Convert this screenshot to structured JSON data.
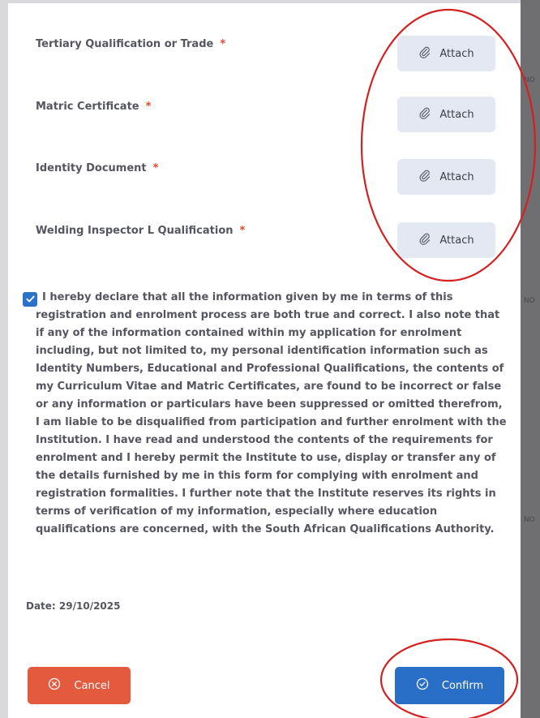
{
  "fields": [
    {
      "label": "Tertiary Qualification or Trade",
      "required": "*",
      "button": "Attach"
    },
    {
      "label": "Matric Certificate",
      "required": "*",
      "button": "Attach"
    },
    {
      "label": "Identity Document",
      "required": "*",
      "button": "Attach"
    },
    {
      "label": "Welding Inspector L Qualification",
      "required": "*",
      "button": "Attach"
    }
  ],
  "declaration": {
    "checked": true,
    "text": "I hereby declare that all the information given by me in terms of this registration and enrolment process are both true and correct. I also note that if any of the information contained within my application for enrolment including, but not limited to, my personal identification information such as Identity Numbers, Educational and Professional Qualifications, the contents of my Curriculum Vitae and Matric Certificates, are found to be incorrect or false or any information or particulars have been suppressed or omitted therefrom, I am liable to be disqualified from participation and further enrolment with the Institution. I have read and understood the contents of the requirements for enrolment and I hereby permit the Institute to use, display or transfer any of the details furnished by me in this form for complying with enrolment and registration formalities. I further note that the Institute reserves its rights in terms of verification of my information, especially where education qualifications are concerned, with the South African Qualifications Authority."
  },
  "date_text": "Date: 29/10/2025",
  "buttons": {
    "cancel": "Cancel",
    "confirm": "Confirm"
  },
  "icons": {
    "attach": "paperclip-icon",
    "cancel": "close-circle-icon",
    "confirm": "check-circle-icon",
    "checkbox": "checkmark-icon"
  },
  "colors": {
    "cancel": "#e35a3e",
    "confirm": "#2a6fc7",
    "attach_bg": "#e3e8f2",
    "required": "#e0452b",
    "annotation": "#d42020"
  },
  "overlay_snippets": [
    "NO",
    "NO",
    "NO"
  ]
}
